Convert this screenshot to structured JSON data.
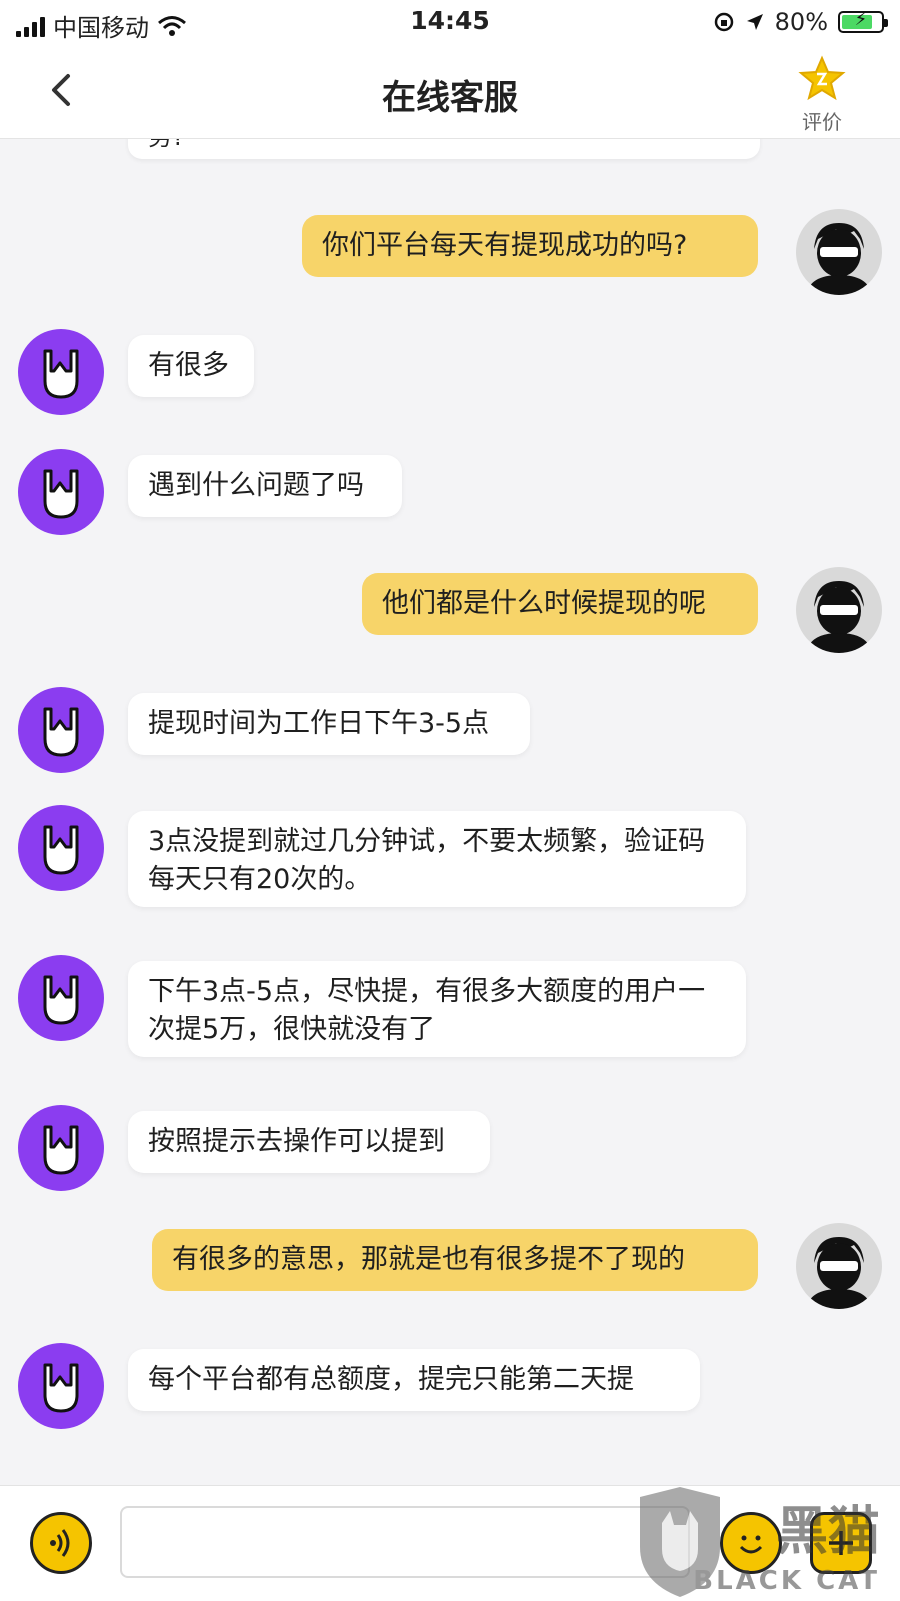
{
  "status_bar": {
    "carrier": "中国移动",
    "time": "14:45",
    "battery": "80%",
    "battery_level": 0.8
  },
  "header": {
    "back_icon": "chevron-left-icon",
    "title": "在线客服",
    "rate_label": "评价",
    "rate_icon": "star-icon"
  },
  "chat": {
    "partial_top_text": "务?",
    "messages": [
      {
        "from": "user",
        "text": "你们平台每天有提现成功的吗?"
      },
      {
        "from": "bot",
        "text": "有很多"
      },
      {
        "from": "bot",
        "text": "遇到什么问题了吗"
      },
      {
        "from": "user",
        "text": "他们都是什么时候提现的呢"
      },
      {
        "from": "bot",
        "text": "提现时间为工作日下午3-5点"
      },
      {
        "from": "bot",
        "text": "3点没提到就过几分钟试，不要太频繁，验证码每天只有20次的。"
      },
      {
        "from": "bot",
        "text": "下午3点-5点，尽快提，有很多大额度的用户一次提5万，很快就没有了"
      },
      {
        "from": "bot",
        "text": "按照提示去操作可以提到"
      },
      {
        "from": "user",
        "text": "有很多的意思，那就是也有很多提不了现的"
      },
      {
        "from": "bot",
        "text": "每个平台都有总额度，提完只能第二天提"
      }
    ]
  },
  "footer": {
    "input_value": "",
    "input_placeholder": ""
  },
  "watermark": {
    "cn": "黑猫",
    "en": "BLACK CAT"
  },
  "colors": {
    "user_bubble": "#f7d469",
    "bot_avatar": "#8b3df0",
    "accent": "#f5c400"
  }
}
